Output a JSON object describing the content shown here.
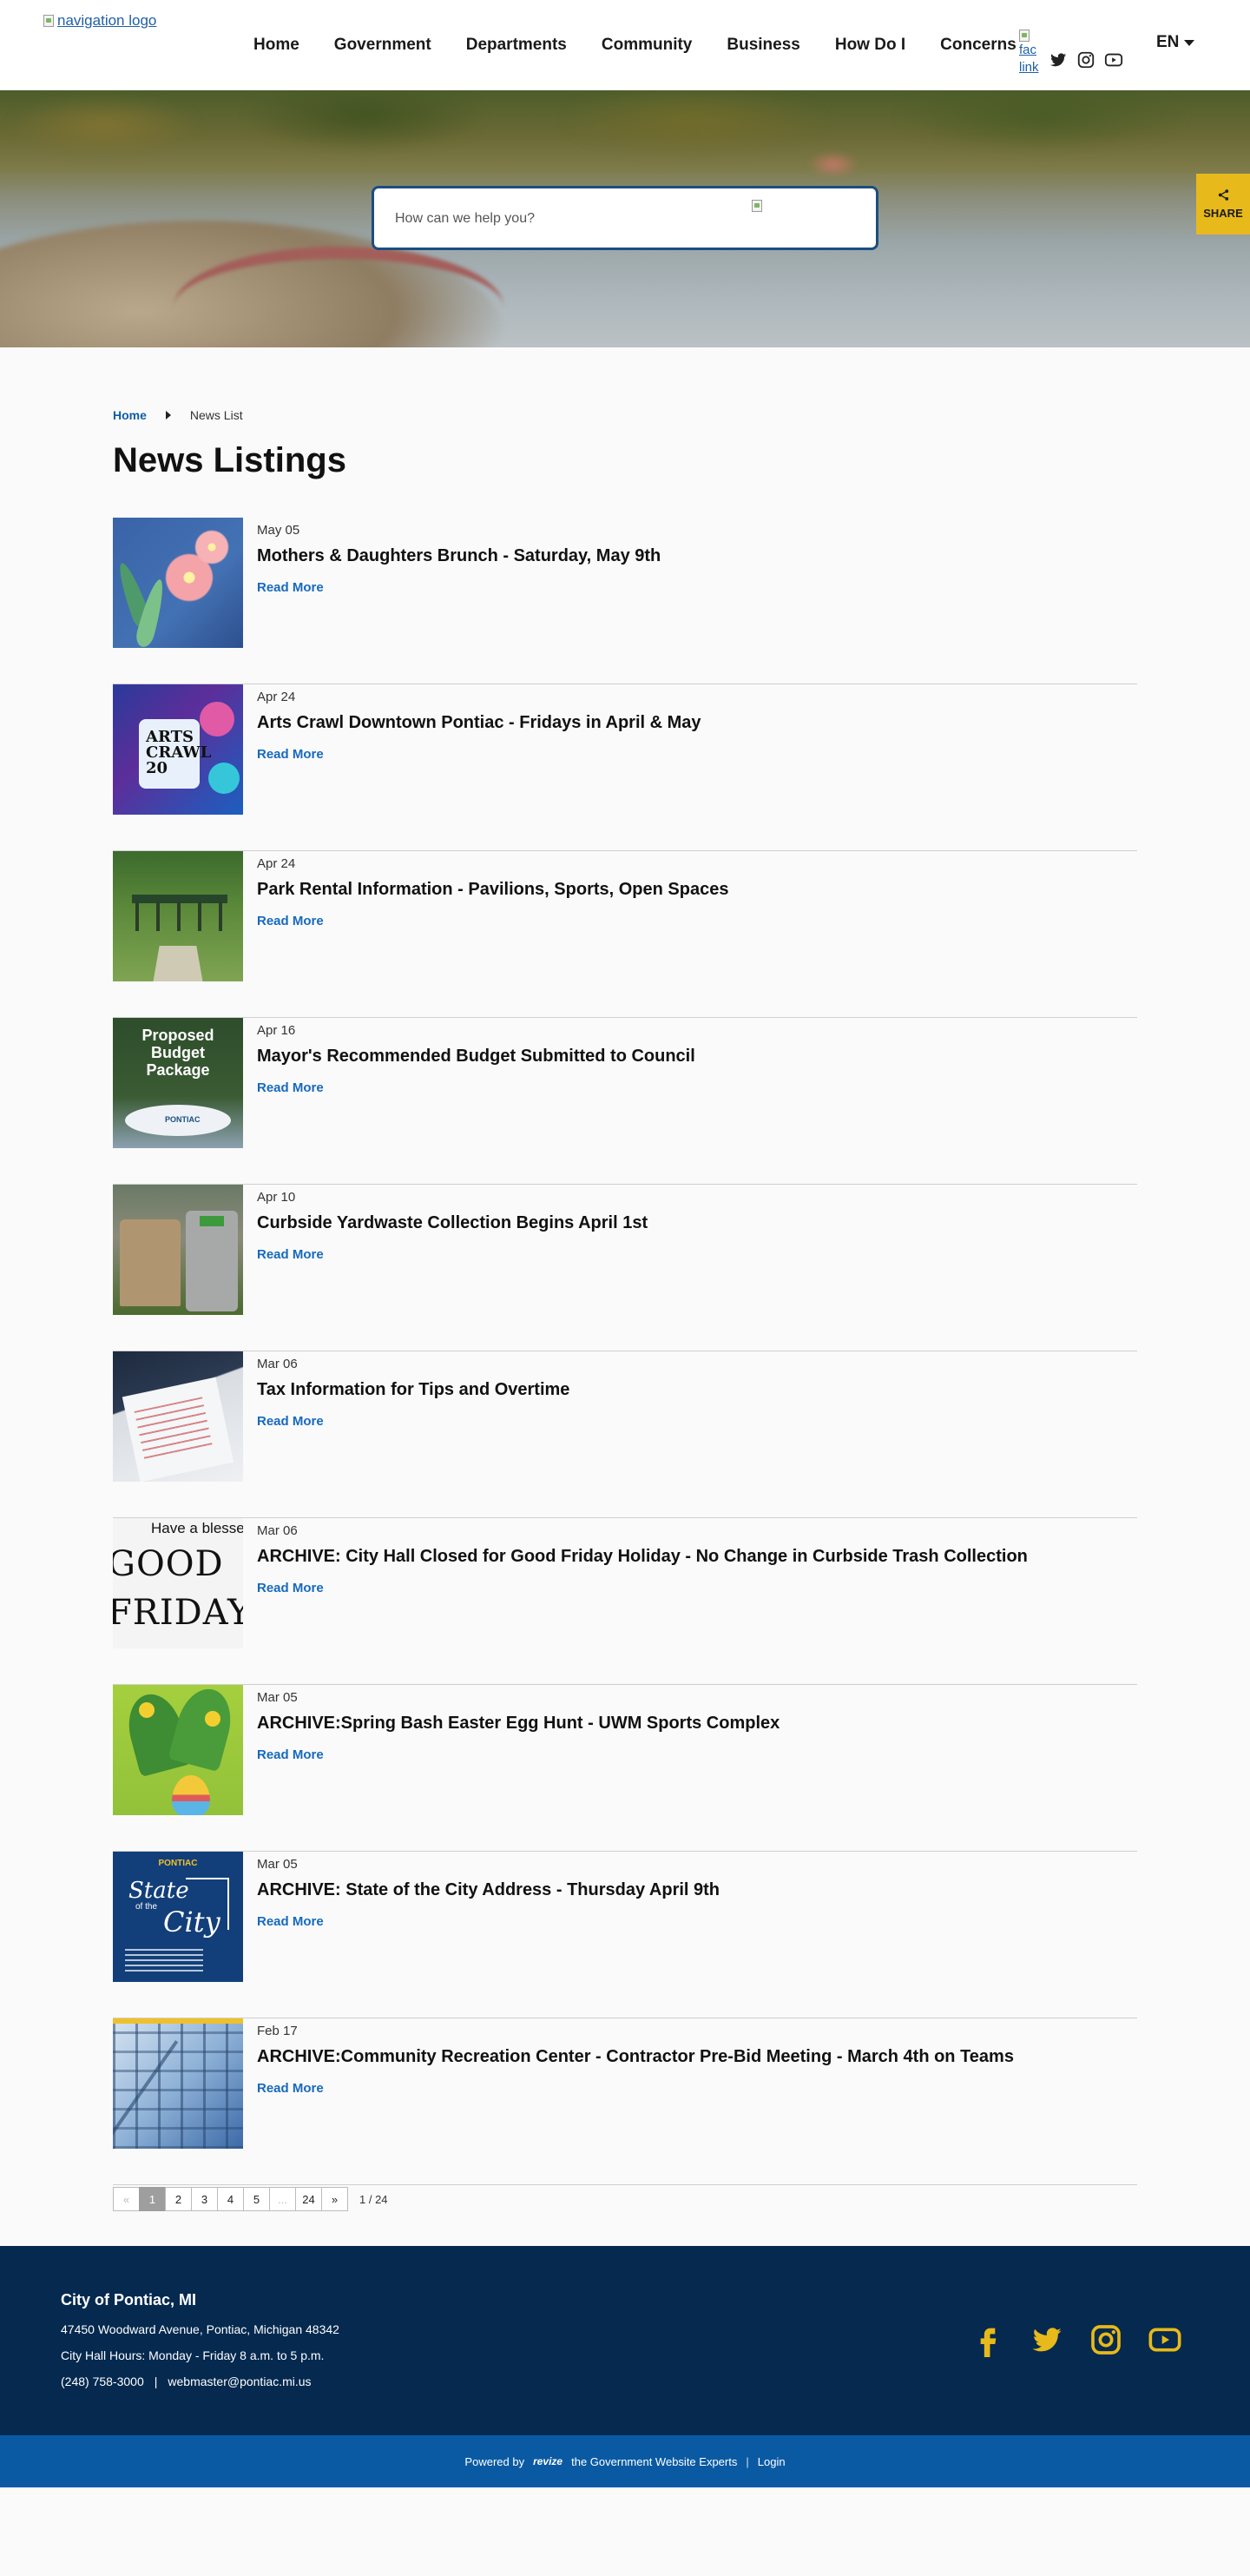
{
  "header": {
    "logo_alt": "navigation logo",
    "nav": [
      "Home",
      "Government",
      "Departments",
      "Community",
      "Business",
      "How Do I",
      "Concerns"
    ],
    "facebook_alt_lines": [
      "fac",
      "link"
    ],
    "social_icons": [
      "twitter-icon",
      "instagram-icon",
      "youtube-icon"
    ],
    "language": "EN"
  },
  "hero": {
    "search_placeholder": "How can we help you?",
    "share_label": "SHARE",
    "accent_color": "#e7b91a"
  },
  "breadcrumb": {
    "home": "Home",
    "current": "News List"
  },
  "page_title": "News Listings",
  "news": [
    {
      "date": "May 05",
      "title": "Mothers & Daughters Brunch - Saturday, May 9th",
      "link": "Read More"
    },
    {
      "date": "Apr 24",
      "title": "Arts Crawl Downtown Pontiac - Fridays in April & May",
      "link": "Read More"
    },
    {
      "date": "Apr 24",
      "title": "Park Rental Information - Pavilions, Sports, Open Spaces",
      "link": "Read More"
    },
    {
      "date": "Apr 16",
      "title": "Mayor's Recommended Budget Submitted to Council",
      "link": "Read More"
    },
    {
      "date": "Apr 10",
      "title": "Curbside Yardwaste Collection Begins April 1st",
      "link": "Read More"
    },
    {
      "date": "Mar 06",
      "title": "Tax Information for Tips and Overtime",
      "link": "Read More"
    },
    {
      "date": "Mar 06",
      "title": "ARCHIVE: City Hall Closed for Good Friday Holiday - No Change in Curbside Trash Collection",
      "link": "Read More"
    },
    {
      "date": "Mar 05",
      "title": "ARCHIVE:Spring Bash Easter Egg Hunt - UWM Sports Complex",
      "link": "Read More"
    },
    {
      "date": "Mar 05",
      "title": "ARCHIVE: State of the City Address - Thursday April 9th",
      "link": "Read More"
    },
    {
      "date": "Feb 17",
      "title": "ARCHIVE:Community Recreation Center - Contractor Pre-Bid Meeting - March 4th on Teams",
      "link": "Read More"
    }
  ],
  "thumb_text": {
    "arts_crawl": "ARTS\nCRAWL\n20",
    "budget": "Proposed\nBudget\nPackage",
    "budget_logo": "PONTIAC",
    "good_friday_1": "Have a blesse",
    "good_friday_2": "GOOD",
    "good_friday_3": "FRIDAY",
    "state_logo": "PONTIAC",
    "state_1": "State",
    "state_2": "of the",
    "state_3": "City"
  },
  "pagination": {
    "prev": "«",
    "pages": [
      "1",
      "2",
      "3",
      "4",
      "5",
      "...",
      "24"
    ],
    "next": "»",
    "current": "1",
    "summary": "1 / 24"
  },
  "footer": {
    "name": "City of Pontiac, MI",
    "address": "47450 Woodward Avenue, Pontiac, Michigan 48342",
    "hours": "City Hall Hours: Monday - Friday 8 a.m. to 5 p.m.",
    "phone": "(248) 758-3000",
    "divider": "|",
    "email": "webmaster@pontiac.mi.us",
    "social_icons": [
      "facebook-icon",
      "twitter-icon",
      "instagram-icon",
      "youtube-icon"
    ],
    "icon_color": "#e7b91a",
    "background": "#05294f"
  },
  "bottom_bar": {
    "powered_by": "Powered by",
    "brand": "revize",
    "tagline": "the Government Website Experts",
    "divider": "|",
    "login": "Login",
    "background": "#0a5aa3"
  }
}
